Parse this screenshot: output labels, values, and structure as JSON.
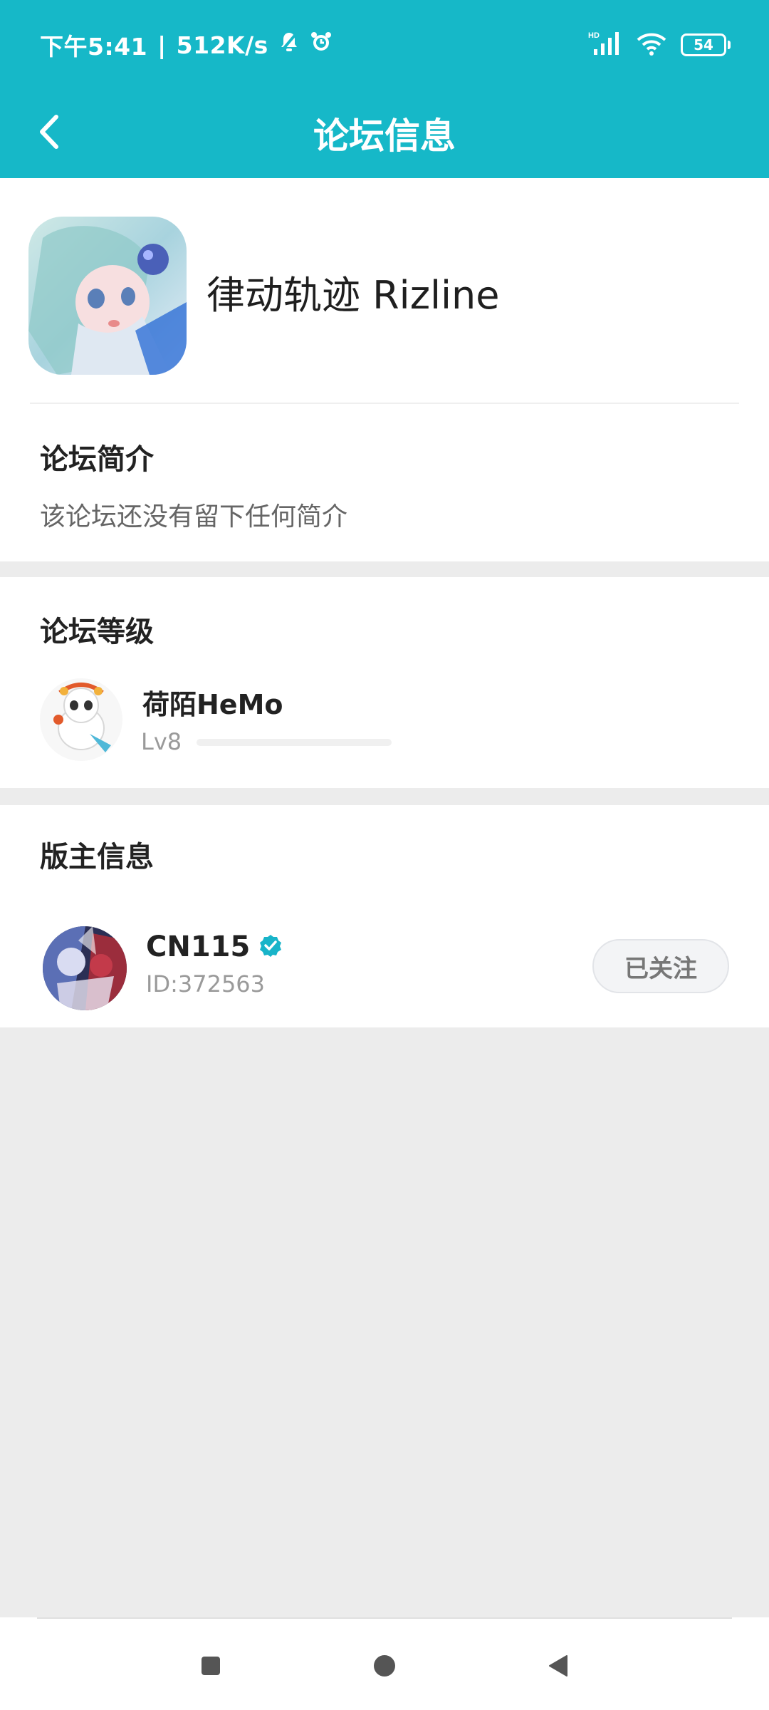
{
  "status": {
    "time": "下午5:41",
    "separator": "|",
    "speed": "512K/s",
    "battery": "54",
    "colors": {
      "bar": "#16b8c8"
    }
  },
  "appbar": {
    "title": "论坛信息",
    "back_icon": "chevron-left-icon"
  },
  "forum": {
    "name": "律动轨迹 Rizline",
    "intro_title": "论坛简介",
    "intro_text": "该论坛还没有留下任何简介"
  },
  "level": {
    "title": "论坛等级",
    "user_name": "荷陌HeMo",
    "level_label": "Lv8",
    "progress": 0.0
  },
  "moderator": {
    "title": "版主信息",
    "name": "CN115",
    "id": "ID:372563",
    "follow_label": "已关注",
    "verified_icon": "verified-badge-icon"
  },
  "navbar": {
    "icons": [
      "recent-apps-icon",
      "home-icon",
      "back-icon"
    ]
  }
}
